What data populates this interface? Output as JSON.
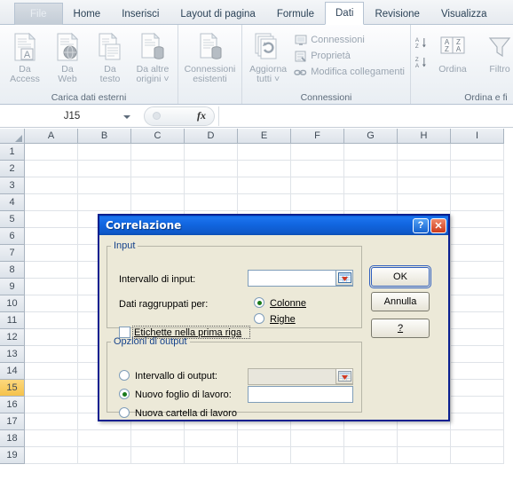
{
  "ribbon": {
    "tabs": [
      {
        "label": "File",
        "active": false,
        "file": true
      },
      {
        "label": "Home",
        "active": false
      },
      {
        "label": "Inserisci",
        "active": false
      },
      {
        "label": "Layout di pagina",
        "active": false
      },
      {
        "label": "Formule",
        "active": false
      },
      {
        "label": "Dati",
        "active": true
      },
      {
        "label": "Revisione",
        "active": false
      },
      {
        "label": "Visualizza",
        "active": false
      }
    ],
    "groups": [
      {
        "title": "Carica dati esterni",
        "buttons": [
          {
            "line1": "Da",
            "line2": "Access",
            "icon": "database-access-icon"
          },
          {
            "line1": "Da",
            "line2": "Web",
            "icon": "web-globe-icon"
          },
          {
            "line1": "Da",
            "line2": "testo",
            "icon": "text-file-icon"
          },
          {
            "line1": "Da altre",
            "line2": "origini ˅",
            "icon": "other-sources-icon"
          }
        ]
      },
      {
        "title": "",
        "buttons": [
          {
            "line1": "Connessioni",
            "line2": "esistenti",
            "icon": "existing-connections-icon"
          }
        ]
      },
      {
        "title": "Connessioni",
        "buttons": [
          {
            "line1": "Aggiorna",
            "line2": "tutti ˅",
            "icon": "refresh-all-icon"
          }
        ],
        "small_buttons": [
          {
            "label": "Connessioni",
            "icon": "connections-icon"
          },
          {
            "label": "Proprietà",
            "icon": "properties-icon"
          },
          {
            "label": "Modifica collegamenti",
            "icon": "edit-links-icon"
          }
        ]
      },
      {
        "title": "Ordina e fi",
        "buttons": [
          {
            "line1": "",
            "line2": "Ordina",
            "icon": "sort-icon"
          },
          {
            "line1": "",
            "line2": "Filtro",
            "icon": "filter-funnel-icon"
          }
        ],
        "small_buttons": [
          {
            "label": "",
            "icon": "sort-az-icon"
          },
          {
            "label": "",
            "icon": "sort-za-icon"
          }
        ]
      }
    ]
  },
  "formula_bar": {
    "name_box_value": "J15",
    "fx_label": "fx",
    "formula_value": ""
  },
  "grid": {
    "columns": [
      "A",
      "B",
      "C",
      "D",
      "E",
      "F",
      "G",
      "H",
      "I"
    ],
    "rows": [
      "1",
      "2",
      "3",
      "4",
      "5",
      "6",
      "7",
      "8",
      "9",
      "10",
      "11",
      "12",
      "13",
      "14",
      "15",
      "16",
      "17",
      "18",
      "19"
    ],
    "selected_row": "15"
  },
  "dialog": {
    "title": "Correlazione",
    "help_button": "?",
    "close_button": "✕",
    "input_group": {
      "legend": "Input",
      "range_label": "Intervallo di input:",
      "range_value": "",
      "range_picker_icon": "range-select-icon",
      "grouped_by_label": "Dati raggruppati per:",
      "options": [
        {
          "label": "Colonne",
          "selected": true
        },
        {
          "label": "Righe",
          "selected": false
        }
      ],
      "labels_checkbox": {
        "label": "Etichette nella prima riga",
        "checked": false
      }
    },
    "output_group": {
      "legend": "Opzioni di output",
      "options": [
        {
          "label": "Intervallo di output:",
          "selected": false,
          "has_field": true,
          "field_value": "",
          "field_disabled": true,
          "picker_icon": "range-select-icon"
        },
        {
          "label": "Nuovo foglio di lavoro:",
          "selected": true,
          "has_field": true,
          "field_value": "",
          "field_disabled": false
        },
        {
          "label": "Nuova cartella di lavoro",
          "selected": false,
          "has_field": false
        }
      ]
    },
    "buttons": [
      {
        "label": "OK",
        "default": true
      },
      {
        "label": "Annulla",
        "default": false
      },
      {
        "label": "?",
        "default": false
      }
    ]
  },
  "colors": {
    "title_bar_blue": "#1166e0",
    "dialog_face": "#ece9d8",
    "dialog_border": "#0a1f8f",
    "legend_text": "#15428b",
    "selected_row_header": "#f5c24b",
    "radio_dot_green": "#1a7a1a"
  }
}
